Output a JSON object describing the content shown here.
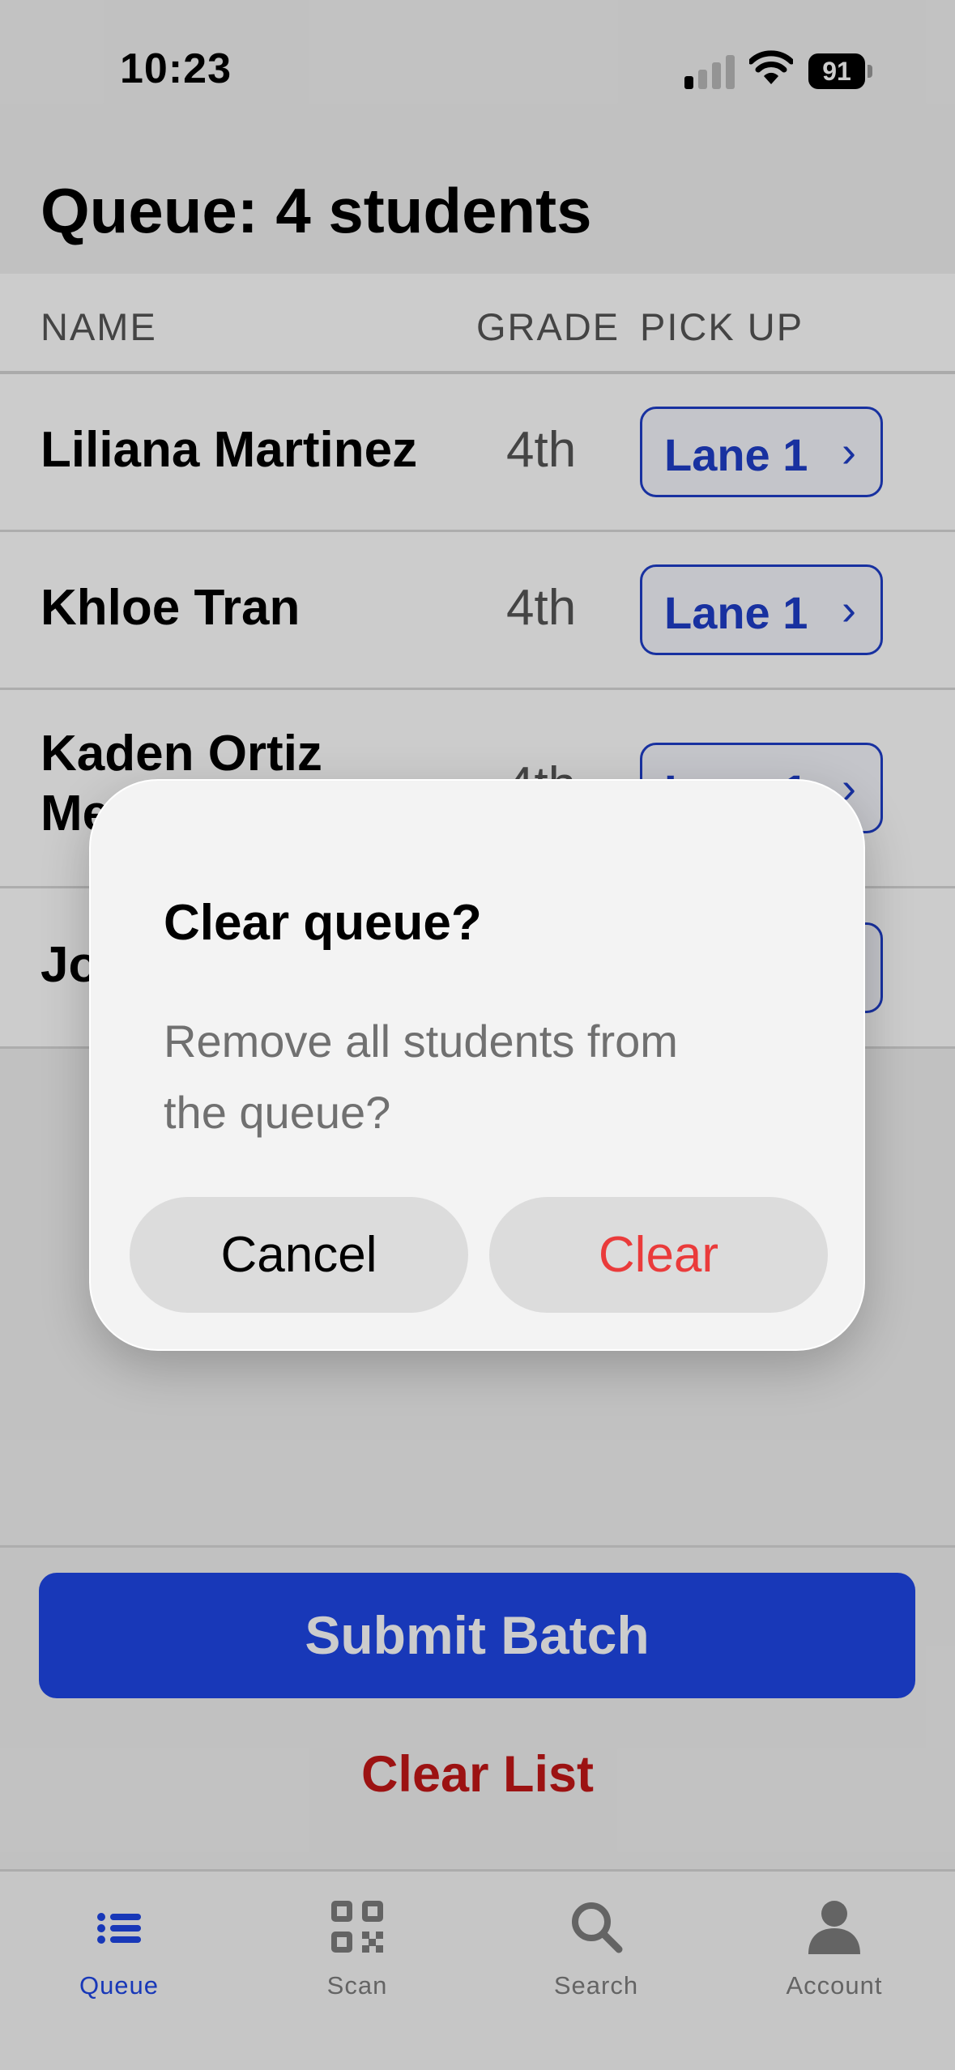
{
  "status_bar": {
    "time": "10:23",
    "battery": "91"
  },
  "header": {
    "title": "Queue: 4 students"
  },
  "table": {
    "columns": {
      "name": "NAME",
      "grade": "GRADE",
      "pickup": "PICK UP"
    },
    "rows": [
      {
        "name": "Liliana Martinez",
        "grade": "4th",
        "lane": "Lane 1"
      },
      {
        "name": "Khloe Tran",
        "grade": "4th",
        "lane": "Lane 1"
      },
      {
        "name": "Kaden Ortiz Me",
        "grade": "4th",
        "lane": "Lane 1"
      },
      {
        "name": "Jo",
        "grade": "",
        "lane": ""
      }
    ]
  },
  "actions": {
    "submit": "Submit Batch",
    "clear_list": "Clear List"
  },
  "dialog": {
    "title": "Clear queue?",
    "message": "Remove all students from the queue?",
    "cancel": "Cancel",
    "confirm": "Clear"
  },
  "tabs": [
    {
      "label": "Queue",
      "icon": "list-icon",
      "active": true
    },
    {
      "label": "Scan",
      "icon": "qr-code-icon",
      "active": false
    },
    {
      "label": "Search",
      "icon": "search-icon",
      "active": false
    },
    {
      "label": "Account",
      "icon": "person-icon",
      "active": false
    }
  ],
  "colors": {
    "accent": "#1f46e6",
    "destructive": "#c41717",
    "dialog_confirm": "#ea3b3b"
  }
}
